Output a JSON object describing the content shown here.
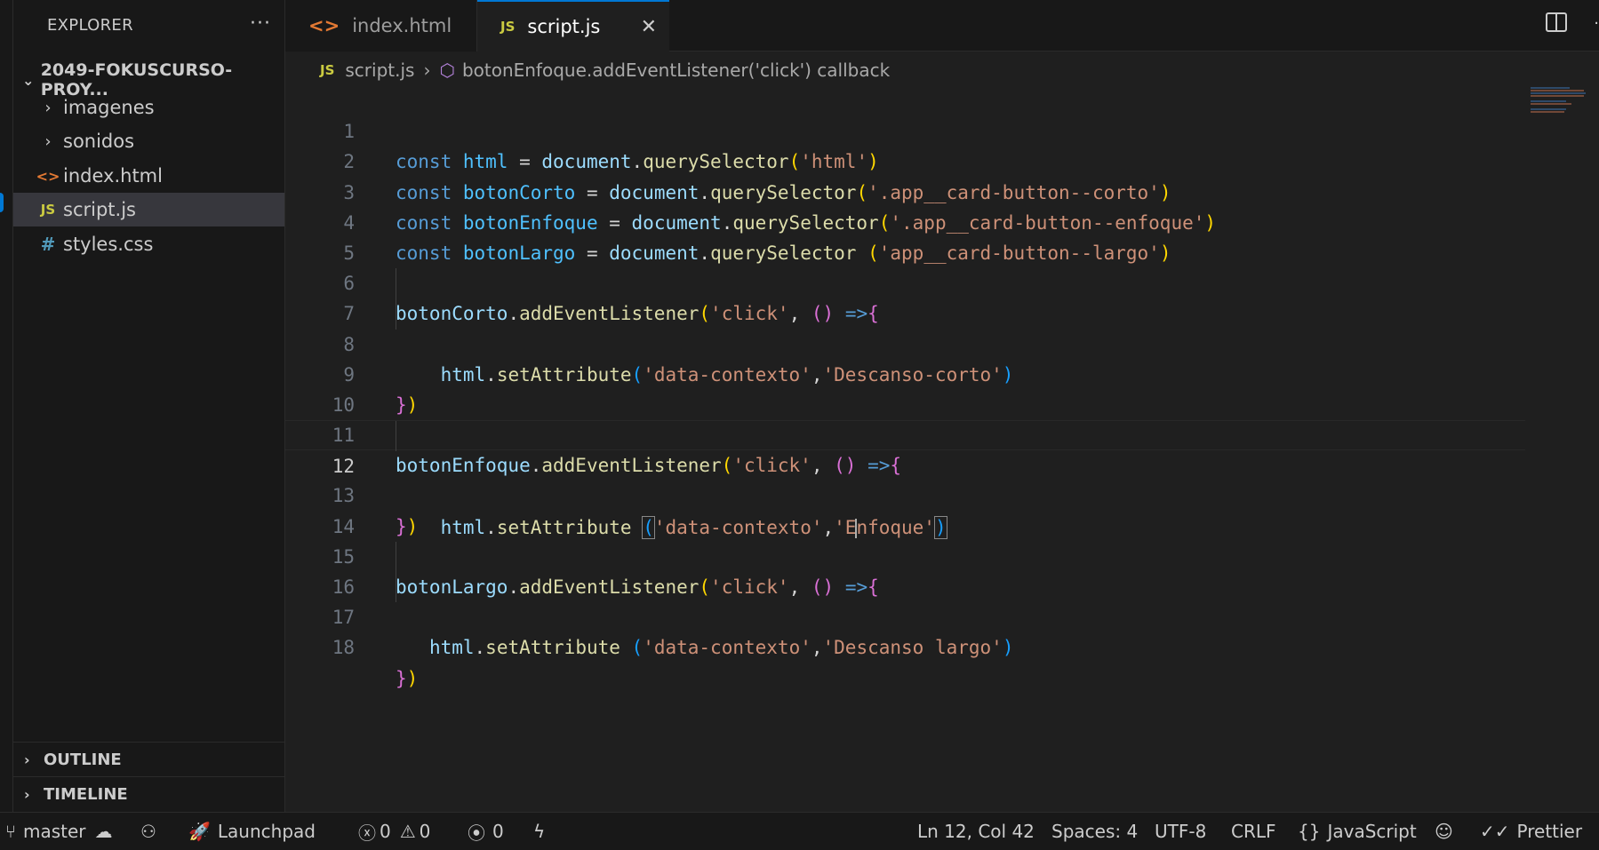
{
  "sidebar": {
    "title": "EXPLORER",
    "more": "···",
    "folder": "2049-FOKUSCURSO-PROY...",
    "items": [
      {
        "label": "imagenes",
        "kind": "folder"
      },
      {
        "label": "sonidos",
        "kind": "folder"
      },
      {
        "label": "index.html",
        "kind": "html",
        "icon": "<>"
      },
      {
        "label": "script.js",
        "kind": "js",
        "icon": "JS"
      },
      {
        "label": "styles.css",
        "kind": "css",
        "icon": "#"
      }
    ],
    "outline": "OUTLINE",
    "timeline": "TIMELINE"
  },
  "tabs": [
    {
      "label": "index.html",
      "icon": "<>"
    },
    {
      "label": "script.js",
      "icon": "JS",
      "close": "✕"
    }
  ],
  "breadcrumb": {
    "file_icon": "JS",
    "file": "script.js",
    "symbol": "botonEnfoque.addEventListener('click') callback"
  },
  "editor": {
    "current_line": 12,
    "line_numbers": [
      "1",
      "2",
      "3",
      "4",
      "5",
      "6",
      "7",
      "8",
      "9",
      "10",
      "11",
      "12",
      "13",
      "14",
      "15",
      "16",
      "17",
      "18"
    ],
    "tokens": {
      "const": "const",
      "html": "html",
      "eq": " = ",
      "document": "document",
      "dot": ".",
      "querySelector": "querySelector",
      "open": "(",
      "close": ")",
      "str_html": "'html'",
      "botonCorto": "botonCorto",
      "str_corto": "'.app__card-button--corto'",
      "botonEnfoque": "botonEnfoque",
      "str_enfoque": "'.app__card-button--enfoque'",
      "botonLargo": "botonLargo",
      "str_largo": "'app__card-button--largo'",
      "addEventListener": "addEventListener",
      "str_click": "'click'",
      "comma": ", ",
      "comma_tight": ",",
      "arrow": " =>",
      "lbrace": "{",
      "rbrace": "}",
      "setAttribute": "setAttribute",
      "str_contexto": "'data-contexto'",
      "str_desc_corto": "'Descanso-corto'",
      "str_enf_a": "'E",
      "str_enf_b": "nfoque'",
      "str_desc_largo": "'Descanso largo'",
      "sp": " ",
      "indent": "    ",
      "indent3": "   "
    }
  },
  "statusbar": {
    "branch": "master",
    "launchpad": "Launchpad",
    "errors": "0",
    "warnings": "0",
    "ports": "0",
    "position": "Ln 12, Col 42",
    "spaces": "Spaces: 4",
    "encoding": "UTF-8",
    "eol": "CRLF",
    "language": "JavaScript",
    "prettier": "Prettier"
  }
}
